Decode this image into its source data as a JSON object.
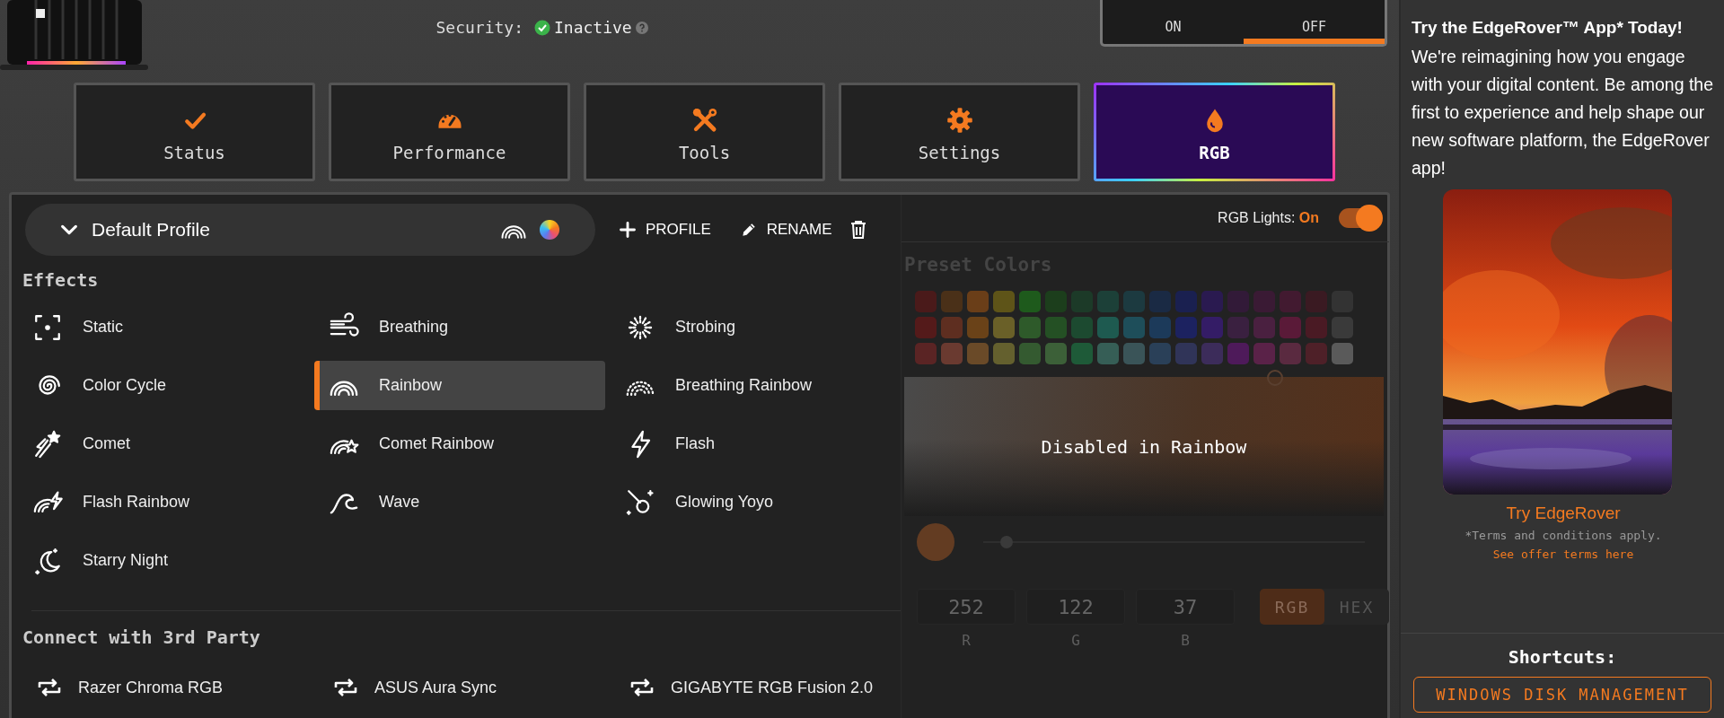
{
  "header": {
    "status": [
      {
        "label": "Security:",
        "value": "Inactive"
      }
    ],
    "gaming_mode": {
      "options": [
        {
          "label": "ON",
          "selected": false
        },
        {
          "label": "OFF",
          "selected": true
        }
      ]
    }
  },
  "tabs": [
    {
      "label": "Status",
      "selected": false
    },
    {
      "label": "Performance",
      "selected": false
    },
    {
      "label": "Tools",
      "selected": false
    },
    {
      "label": "Settings",
      "selected": false
    },
    {
      "label": "RGB",
      "selected": true
    }
  ],
  "profile": {
    "name": "Default Profile",
    "actions": [
      "PROFILE",
      "RENAME"
    ]
  },
  "effects": {
    "title": "Effects",
    "items": [
      {
        "label": "Static",
        "selected": false
      },
      {
        "label": "Breathing",
        "selected": false
      },
      {
        "label": "Strobing",
        "selected": false
      },
      {
        "label": "Color Cycle",
        "selected": false
      },
      {
        "label": "Rainbow",
        "selected": true
      },
      {
        "label": "Breathing Rainbow",
        "selected": false
      },
      {
        "label": "Comet",
        "selected": false
      },
      {
        "label": "Comet Rainbow",
        "selected": false
      },
      {
        "label": "Flash",
        "selected": false
      },
      {
        "label": "Flash Rainbow",
        "selected": false
      },
      {
        "label": "Wave",
        "selected": false
      },
      {
        "label": "Glowing Yoyo",
        "selected": false
      },
      {
        "label": "Starry Night",
        "selected": false
      }
    ]
  },
  "third_party": {
    "title": "Connect with 3rd Party",
    "items": [
      {
        "label": "Razer Chroma RGB"
      },
      {
        "label": "ASUS Aura Sync"
      },
      {
        "label": "GIGABYTE RGB Fusion 2.0"
      }
    ]
  },
  "rgb_lights": {
    "label": "RGB Lights:",
    "value": "On",
    "on": true
  },
  "colors": {
    "disabled": true,
    "title": "Preset Colors",
    "swatches": [
      [
        {
          "color": "#4a1a1a"
        },
        {
          "color": "#4a3018"
        },
        {
          "color": "#6a3e18"
        },
        {
          "color": "#5e5418"
        },
        {
          "color": "#1e5a1c"
        },
        {
          "color": "#1c3e1c"
        },
        {
          "color": "#1c3a28"
        },
        {
          "color": "#1c4038"
        },
        {
          "color": "#1c3a40"
        },
        {
          "color": "#1a2a44"
        },
        {
          "color": "#1a2050"
        },
        {
          "color": "#2a1a50"
        },
        {
          "color": "#321a38"
        },
        {
          "color": "#3a1a34"
        },
        {
          "color": "#421a30"
        },
        {
          "color": "#3a1a22"
        },
        {
          "color": "#333333"
        }
      ],
      [
        {
          "color": "#541a1a"
        },
        {
          "color": "#5e2e20"
        },
        {
          "color": "#6a4218"
        },
        {
          "color": "#6a6028"
        },
        {
          "color": "#2e5a2a"
        },
        {
          "color": "#245024"
        },
        {
          "color": "#1c4a30"
        },
        {
          "color": "#1e5a50"
        },
        {
          "color": "#1e4e5a"
        },
        {
          "color": "#1c3a5a"
        },
        {
          "color": "#1c2260"
        },
        {
          "color": "#341c66"
        },
        {
          "color": "#3a2040"
        },
        {
          "color": "#4a2040"
        },
        {
          "color": "#5a1a38"
        },
        {
          "color": "#4a1a24"
        },
        {
          "color": "#3a3a3a"
        }
      ],
      [
        {
          "color": "#5a2424"
        },
        {
          "color": "#6a3a30"
        },
        {
          "color": "#6a4a28"
        },
        {
          "color": "#64602e"
        },
        {
          "color": "#345a30"
        },
        {
          "color": "#3c6038"
        },
        {
          "color": "#1e5a38"
        },
        {
          "color": "#365e56"
        },
        {
          "color": "#3a5458"
        },
        {
          "color": "#2a4058"
        },
        {
          "color": "#303458"
        },
        {
          "color": "#3c2c5a"
        },
        {
          "color": "#4e1a5a"
        },
        {
          "color": "#5a2248"
        },
        {
          "color": "#5a2a40"
        },
        {
          "color": "#4e2028"
        },
        {
          "color": "#5a5a5a"
        }
      ]
    ],
    "overlay": "Disabled in Rainbow",
    "hue_slider": {
      "level": 0.06
    },
    "fields": [
      {
        "value": "252",
        "label": "R"
      },
      {
        "value": "122",
        "label": "G"
      },
      {
        "value": "37",
        "label": "B"
      }
    ],
    "modes": [
      {
        "label": "RGB",
        "selected": true
      },
      {
        "label": "HEX",
        "selected": false
      }
    ]
  },
  "sidebar": {
    "title": "Try the EdgeRover™ App* Today!",
    "body": "We're reimagining how you engage with your digital content. Be among the first to experience and help shape our new software platform, the EdgeRover app!",
    "link": "Try EdgeRover",
    "terms": "*Terms and conditions apply.",
    "terms_link": "See offer terms here",
    "shortcuts_title": "Shortcuts:",
    "shortcuts": [
      "WINDOWS DISK MANAGEMENT"
    ]
  }
}
